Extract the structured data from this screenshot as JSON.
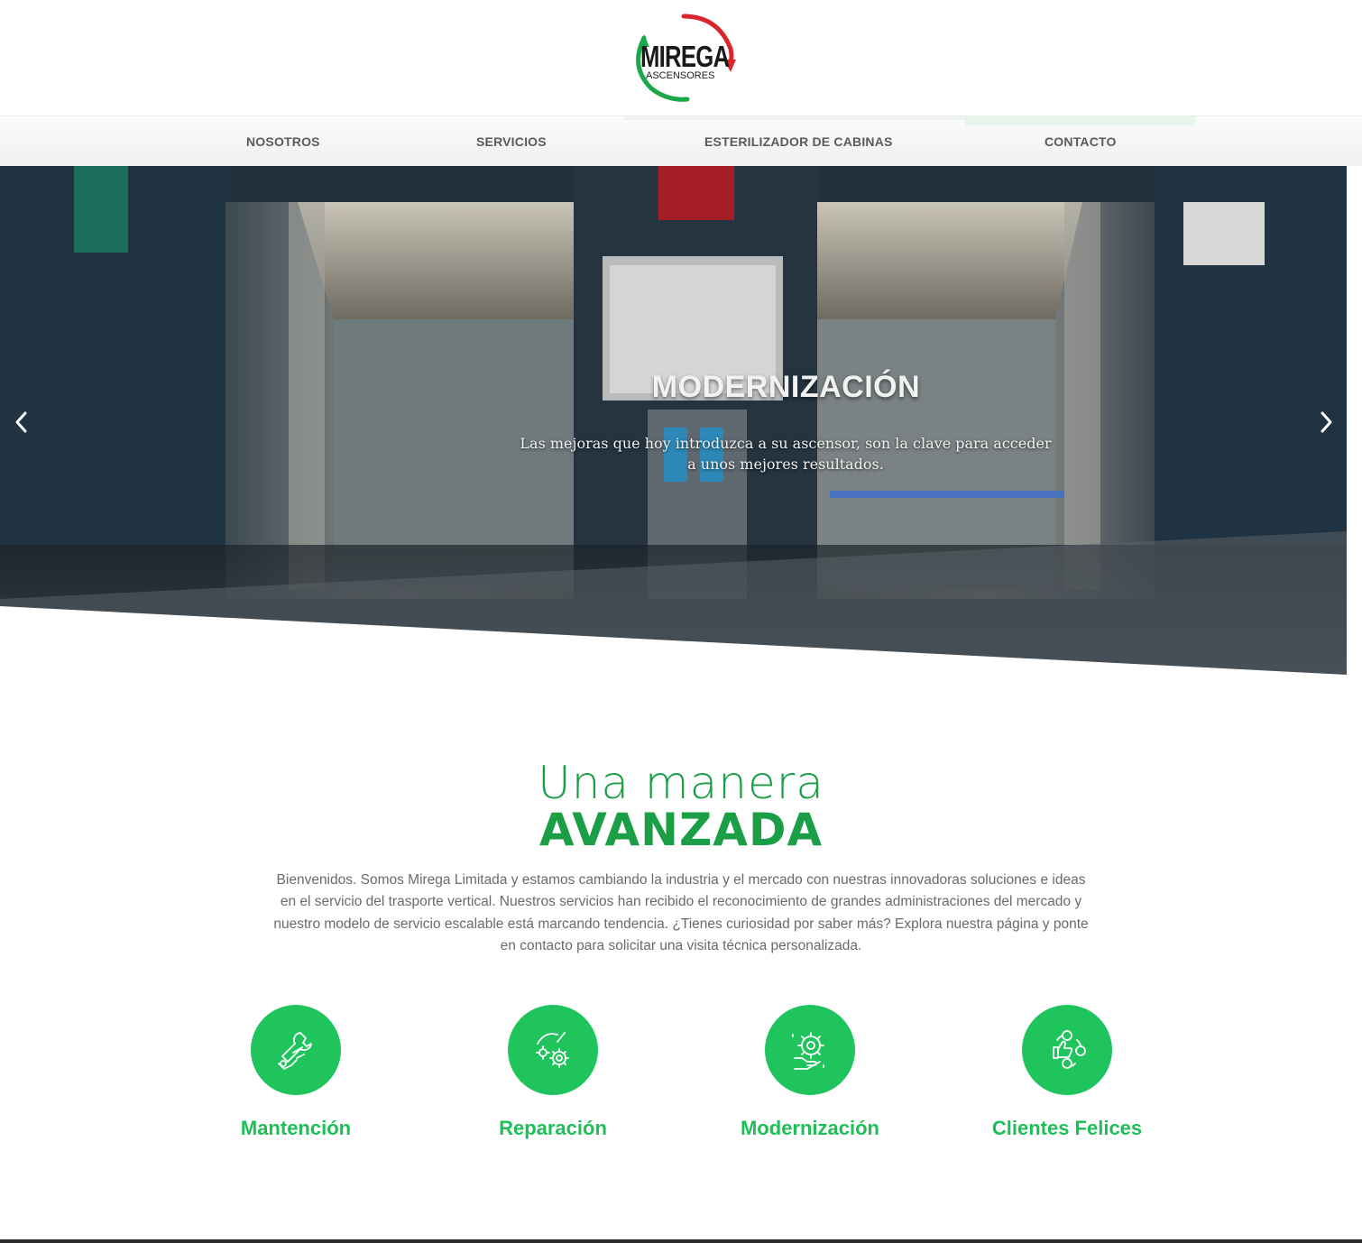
{
  "logo": {
    "name": "MIREGA",
    "sub": "ASCENSORES"
  },
  "nav": {
    "items": [
      {
        "label": "NOSOTROS"
      },
      {
        "label": "SERVICIOS"
      },
      {
        "label": "ESTERILIZADOR DE CABINAS"
      },
      {
        "label": "CONTACTO"
      }
    ]
  },
  "hero": {
    "title": "MODERNIZACIÓN",
    "subtitle": "Las mejoras que hoy introduzca a su ascensor, son la clave para acceder a unos mejores resultados.",
    "prev_icon": "chevron-left-icon",
    "next_icon": "chevron-right-icon"
  },
  "intro": {
    "heading_light": "Una manera",
    "heading_bold": "AVANZADA",
    "text": "Bienvenidos. Somos Mirega Limitada y estamos cambiando la industria y el mercado con nuestras innovadoras soluciones e ideas en el servicio del trasporte vertical. Nuestros servicios han recibido el reconocimiento de grandes administraciones del mercado y nuestro modelo de servicio escalable está marcando tendencia. ¿Tienes curiosidad por saber más? Explora nuestra página y ponte en contacto para solicitar una visita técnica personalizada."
  },
  "features": [
    {
      "label": "Mantención",
      "icon": "wrench-hand-icon"
    },
    {
      "label": "Reparación",
      "icon": "gears-repair-icon"
    },
    {
      "label": "Modernización",
      "icon": "gear-hand-icon"
    },
    {
      "label": "Clientes Felices",
      "icon": "thumbs-up-icon"
    }
  ],
  "colors": {
    "brand_green": "#1fc45d",
    "heading_green": "#1a9e46",
    "logo_red": "#d8262c",
    "nav_text": "#5b5b5b"
  }
}
